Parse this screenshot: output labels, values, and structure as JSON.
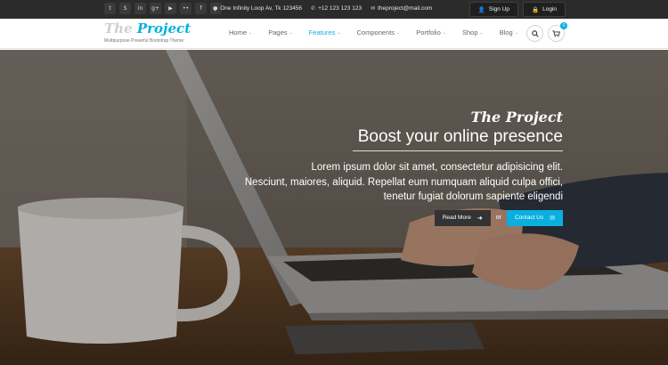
{
  "topbar": {
    "social": [
      {
        "icon": "twitter-icon",
        "glyph": "t"
      },
      {
        "icon": "skype-icon",
        "glyph": "S"
      },
      {
        "icon": "linkedin-icon",
        "glyph": "in"
      },
      {
        "icon": "google-plus-icon",
        "glyph": "g+"
      },
      {
        "icon": "youtube-icon",
        "glyph": "▶"
      },
      {
        "icon": "flickr-icon",
        "glyph": "••"
      },
      {
        "icon": "facebook-icon",
        "glyph": "f"
      },
      {
        "icon": "pinterest-icon",
        "glyph": "p"
      }
    ],
    "address": "One Infinity Loop Av, Tk 123456",
    "phone": "+12 123 123 123",
    "email": "theproject@mail.com",
    "signup_label": "Sign Up",
    "login_label": "Login"
  },
  "header": {
    "logo_the": "The",
    "logo_project": "Project",
    "tagline": "Multipurpose Powerful Bootstrap Theme",
    "nav": [
      "Home",
      "Pages",
      "Features",
      "Components",
      "Portfolio",
      "Shop",
      "Blog"
    ],
    "active_nav": "Features",
    "cart_count": "0"
  },
  "hero": {
    "brand": "The Project",
    "headline": "Boost your online presence",
    "lines": [
      "Lorem ipsum dolor sit amet, consectetur adipisicing elit.",
      "Nesciunt, maiores, aliquid. Repellat eum numquam aliquid culpa offici,",
      "tenetur fugiat dolorum sapiente eligendi"
    ],
    "read_more_label": "Read More",
    "or_label": "or",
    "contact_label": "Contact Us"
  },
  "colors": {
    "accent": "#09afdf",
    "topbar": "#2b2b2b",
    "dark_button": "#333333"
  }
}
